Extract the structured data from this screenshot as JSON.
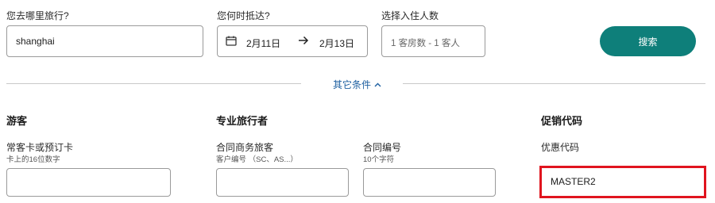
{
  "destination": {
    "label": "您去哪里旅行?",
    "value": "shanghai"
  },
  "dates": {
    "label": "您何时抵达?",
    "checkin": "2月11日",
    "checkout": "2月13日"
  },
  "guests": {
    "label": "选择入住人数",
    "value": "1 客房数 - 1 客人"
  },
  "search": {
    "label": "搜索"
  },
  "more_options": {
    "label": "其它条件"
  },
  "guest_section": {
    "title": "游客",
    "frequent_flyer": {
      "label": "常客卡或预订卡",
      "hint": "卡上的16位数字",
      "value": ""
    }
  },
  "pro_section": {
    "title": "专业旅行者",
    "corporate": {
      "label": "合同商务旅客",
      "hint": "客户编号 （SC、AS...）",
      "value": ""
    },
    "contract": {
      "label": "合同编号",
      "hint": "10个字符",
      "value": ""
    }
  },
  "promo_section": {
    "title": "促销代码",
    "code": {
      "label": "优惠代码",
      "value": "MASTER2"
    }
  },
  "colors": {
    "accent": "#0e7f7a",
    "link": "#1d5fa0",
    "highlight": "#e0141e"
  }
}
